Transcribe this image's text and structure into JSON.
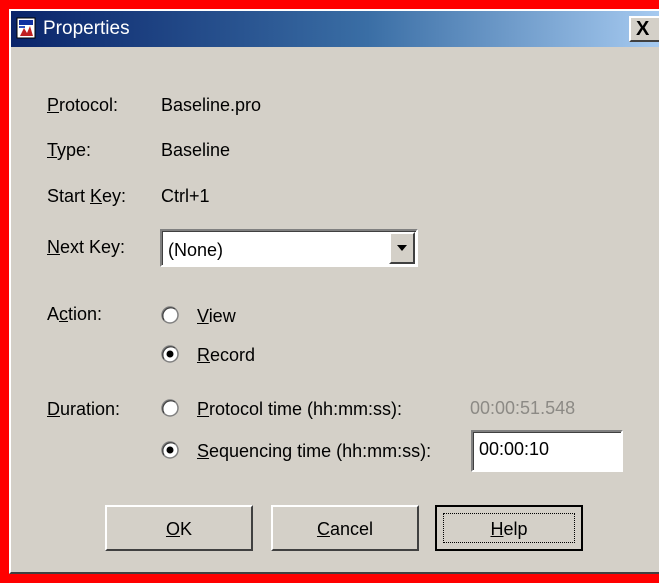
{
  "window": {
    "title": "Properties",
    "close_label": "X",
    "frame_color": "#ff0000",
    "title_gradient": [
      "#0a246a",
      "#a6caf0"
    ]
  },
  "fields": {
    "protocol": {
      "label_key": "P",
      "label_rest": "rotocol:",
      "value": "Baseline.pro"
    },
    "type": {
      "label_key": "T",
      "label_rest": "ype:",
      "value": "Baseline"
    },
    "start_key": {
      "label_pre": "Start ",
      "label_key": "K",
      "label_rest": "ey:",
      "value": "Ctrl+1"
    },
    "next_key": {
      "label_key": "N",
      "label_rest": "ext Key:",
      "selected": "(None)"
    }
  },
  "action": {
    "label_pre": "A",
    "label_key": "c",
    "label_rest": "tion:",
    "options": [
      {
        "key": "V",
        "rest": "iew",
        "checked": false
      },
      {
        "key": "R",
        "pre": "",
        "rest_pre": "",
        "rest": "ecord",
        "checked": true
      }
    ]
  },
  "duration": {
    "label_key": "D",
    "label_rest": "uration:",
    "protocol_time": {
      "key": "P",
      "rest": "rotocol time (hh:mm:ss):",
      "value": "00:00:51.548",
      "checked": false
    },
    "sequencing_time": {
      "key": "S",
      "rest": "equencing time (hh:mm:ss):",
      "value": "00:00:10",
      "checked": true
    }
  },
  "buttons": {
    "ok": {
      "key": "O",
      "rest": "K"
    },
    "cancel": {
      "key": "C",
      "rest": "ancel"
    },
    "help": {
      "key": "H",
      "rest": "elp"
    }
  },
  "icons": {
    "title_icon": "properties-app-icon",
    "combo_arrow": "chevron-down-icon"
  }
}
